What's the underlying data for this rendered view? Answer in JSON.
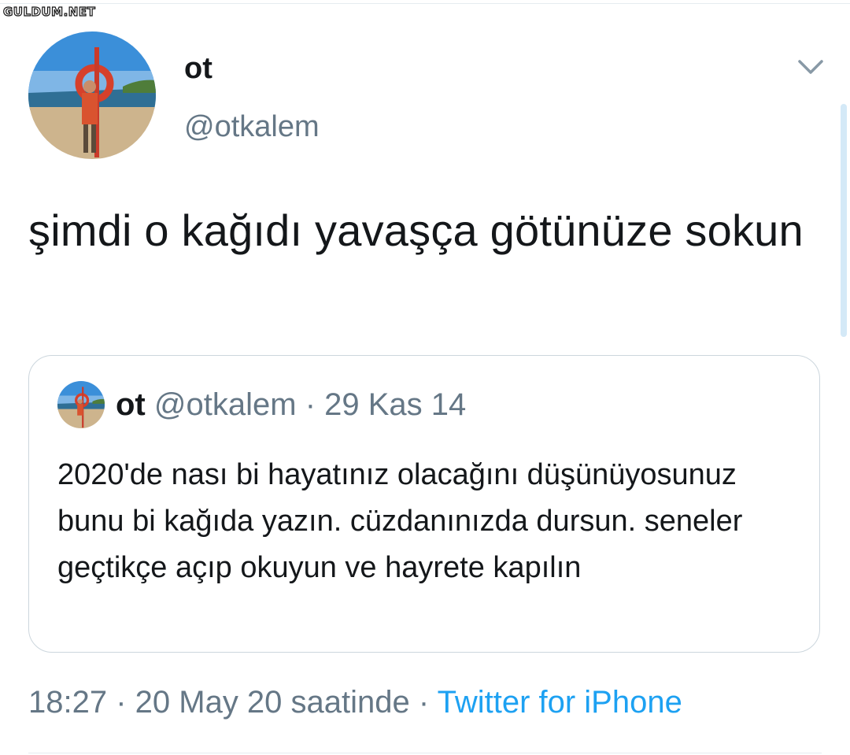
{
  "watermark": "GULDUM.NET",
  "tweet": {
    "display_name": "ot",
    "handle": "@otkalem",
    "text": "şimdi o kağıdı yavaşça götünüze sokun",
    "time": "18:27 · 20 May 20 saatinde ·",
    "source": "Twitter for iPhone"
  },
  "quoted_tweet": {
    "display_name": "ot",
    "handle": "@otkalem",
    "date": "· 29 Kas 14",
    "text": "2020'de nası bi hayatınız olacağını düşünüyosunuz bunu bi kağıda yazın. cüzdanınızda dursun. seneler geçtikçe açıp okuyun ve hayrete kapılın"
  },
  "icons": {
    "more_menu": "chevron-down-icon"
  },
  "colors": {
    "link_blue": "#1da1f2",
    "secondary_text": "#657786",
    "border": "#ccd6dd"
  }
}
